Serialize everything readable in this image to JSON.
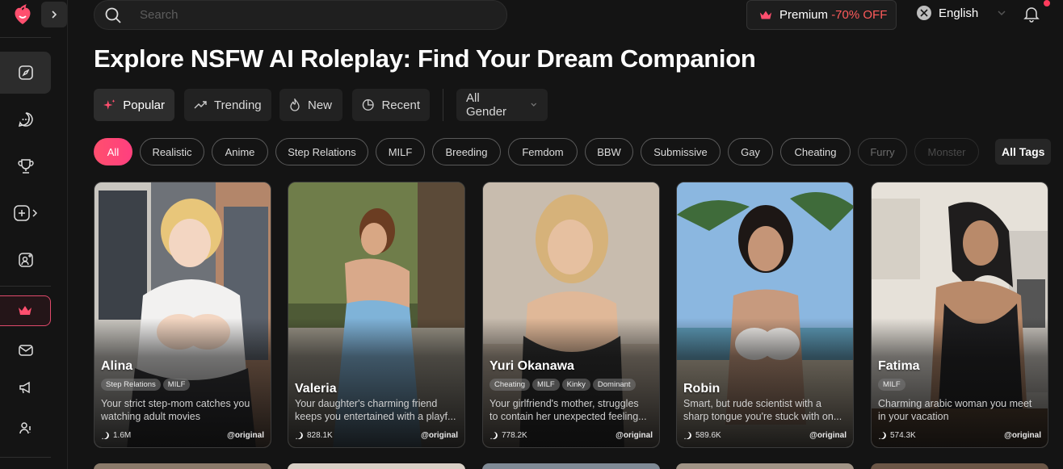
{
  "search": {
    "placeholder": "Search"
  },
  "header": {
    "premium_label": "Premium",
    "premium_discount": "-70% OFF",
    "language": "English"
  },
  "page": {
    "title": "Explore NSFW AI Roleplay: Find Your Dream Companion"
  },
  "sort_tabs": [
    {
      "label": "Popular",
      "icon": "sparkles-icon",
      "active": true
    },
    {
      "label": "Trending",
      "icon": "trending-icon"
    },
    {
      "label": "New",
      "icon": "flame-icon"
    },
    {
      "label": "Recent",
      "icon": "clock-icon"
    }
  ],
  "gender_filter": {
    "label": "All Gender"
  },
  "tags": [
    "All",
    "Realistic",
    "Anime",
    "Step Relations",
    "MILF",
    "Breeding",
    "Femdom",
    "BBW",
    "Submissive",
    "Gay",
    "Cheating",
    "Furry",
    "Monster"
  ],
  "all_tags_label": "All Tags",
  "cards": [
    {
      "name": "Alina",
      "tags": [
        "Step Relations",
        "MILF"
      ],
      "desc1": "Your strict step-mom catches you",
      "desc2": "watching adult movies",
      "count": "1.6M",
      "author": "@original"
    },
    {
      "name": "Valeria",
      "tags": [],
      "desc1": "Your daughter's charming friend",
      "desc2": "keeps you entertained with a playf...",
      "count": "828.1K",
      "author": "@original"
    },
    {
      "name": "Yuri Okanawa",
      "tags": [
        "Cheating",
        "MILF",
        "Kinky",
        "Dominant"
      ],
      "desc1": "Your girlfriend's mother, struggles",
      "desc2": "to contain her unexpected feeling...",
      "count": "778.2K",
      "author": "@original"
    },
    {
      "name": "Robin",
      "tags": [],
      "desc1": "Smart, but rude scientist with a",
      "desc2": "sharp tongue you're stuck with on...",
      "count": "589.6K",
      "author": "@original"
    },
    {
      "name": "Fatima",
      "tags": [
        "MILF"
      ],
      "desc1": "Charming arabic woman you meet",
      "desc2": "in your vacation",
      "count": "574.3K",
      "author": "@original"
    }
  ],
  "colors": {
    "accent": "#ff4f6e",
    "background": "#141414",
    "discount": "#ff5b5b"
  }
}
